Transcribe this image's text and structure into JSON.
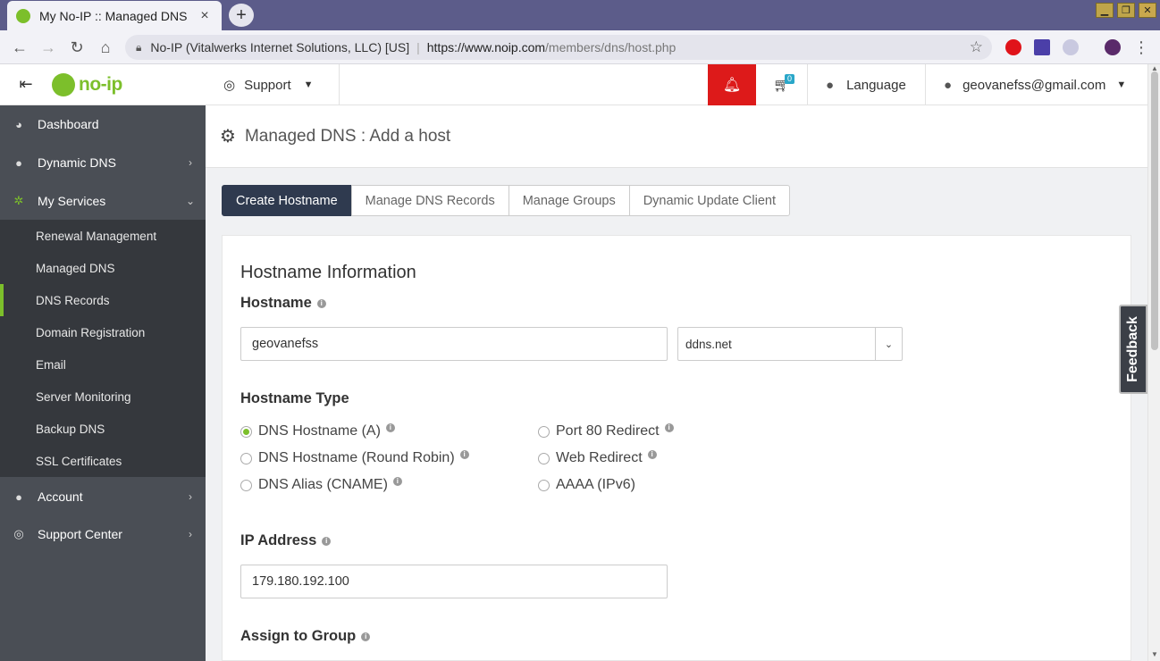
{
  "browser": {
    "tab_title": "My No-IP :: Managed DNS",
    "tab_close": "×",
    "new_tab": "+",
    "site_org": "No-IP (Vitalwerks Internet Solutions, LLC) [US]",
    "url_host": "https://www.noip.com",
    "url_path": "/members/dns/host.php"
  },
  "brand": {
    "logo_text": "no-ip"
  },
  "sidebar": {
    "items": [
      {
        "label": "Dashboard"
      },
      {
        "label": "Dynamic DNS"
      },
      {
        "label": "My Services"
      },
      {
        "label": "Account"
      },
      {
        "label": "Support Center"
      }
    ],
    "sub_items": [
      {
        "label": "Renewal Management"
      },
      {
        "label": "Managed DNS"
      },
      {
        "label": "DNS Records"
      },
      {
        "label": "Domain Registration"
      },
      {
        "label": "Email"
      },
      {
        "label": "Server Monitoring"
      },
      {
        "label": "Backup DNS"
      },
      {
        "label": "SSL Certificates"
      }
    ]
  },
  "header": {
    "support_label": "Support",
    "cart_count": "0",
    "language_label": "Language",
    "user_email": "geovanefss@gmail.com"
  },
  "page": {
    "title": "Managed DNS : Add a host",
    "tabs": [
      {
        "label": "Create Hostname"
      },
      {
        "label": "Manage DNS Records"
      },
      {
        "label": "Manage Groups"
      },
      {
        "label": "Dynamic Update Client"
      }
    ]
  },
  "form": {
    "section_title": "Hostname Information",
    "hostname_label": "Hostname",
    "hostname_value": "geovanefss",
    "domain_value": "ddns.net",
    "hostname_type_label": "Hostname Type",
    "types": [
      {
        "label": "DNS Hostname (A)",
        "selected": true
      },
      {
        "label": "DNS Hostname (Round Robin)",
        "selected": false
      },
      {
        "label": "DNS Alias (CNAME)",
        "selected": false
      },
      {
        "label": "Port 80 Redirect",
        "selected": false
      },
      {
        "label": "Web Redirect",
        "selected": false
      },
      {
        "label": "AAAA (IPv6)",
        "selected": false
      }
    ],
    "ip_label": "IP Address",
    "ip_value": "179.180.192.100",
    "group_label": "Assign to Group"
  },
  "feedback_label": "Feedback",
  "colors": {
    "brand_green": "#7cbf2b",
    "alert_red": "#dd1a1a",
    "sidebar_bg": "#4a4e55",
    "tab_active": "#2f3a4f"
  }
}
